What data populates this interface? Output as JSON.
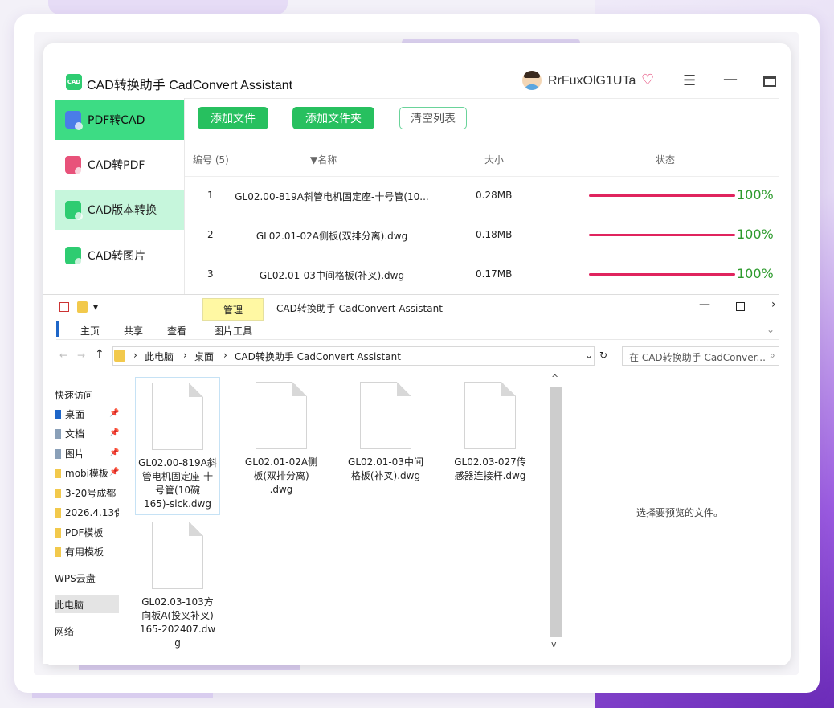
{
  "app": {
    "logo_text": "CAD",
    "title": "CAD转换助手 CadConvert Assistant",
    "username": "RrFuxOlG1UTa",
    "icons": {
      "vip": "diamond-icon",
      "menu": "hamburger-icon",
      "minimize": "minimize-icon",
      "maximize": "maximize-icon"
    },
    "nav": [
      {
        "label": "PDF转CAD",
        "icon_color": "#4a7de8",
        "state": "active"
      },
      {
        "label": "CAD转PDF",
        "icon_color": "#e8527a",
        "state": "normal"
      },
      {
        "label": "CAD版本转换",
        "icon_color": "#2ecc71",
        "state": "highlight"
      },
      {
        "label": "CAD转图片",
        "icon_color": "#2ecc71",
        "state": "normal"
      }
    ],
    "toolbar": {
      "add_file": "添加文件",
      "add_folder": "添加文件夹",
      "clear_list": "清空列表"
    },
    "table": {
      "headers": {
        "num": "编号 (5)",
        "name": "▼名称",
        "size": "大小",
        "status": "状态"
      },
      "rows": [
        {
          "num": "1",
          "name": "GL02.00-819A斜管电机固定座-十号管(10...",
          "size": "0.28MB",
          "progress": "100%"
        },
        {
          "num": "2",
          "name": "GL02.01-02A侧板(双排分离).dwg",
          "size": "0.18MB",
          "progress": "100%"
        },
        {
          "num": "3",
          "name": "GL02.01-03中间格板(补叉).dwg",
          "size": "0.17MB",
          "progress": "100%"
        }
      ]
    },
    "colors": {
      "accent_green": "#27c05f",
      "progress_bar": "#e0245e",
      "progress_text": "#2e9b2e"
    }
  },
  "explorer": {
    "quick_dropdown": "▾",
    "ribbon_context_tab": "管理",
    "window_title": "CAD转换助手 CadConvert Assistant",
    "window_controls": {
      "minimize": "—",
      "close": "›"
    },
    "ribbon_tabs": [
      "主页",
      "共享",
      "查看",
      "图片工具"
    ],
    "ribbon_expand": "⌄",
    "nav_arrows": {
      "back": "←",
      "forward": "→",
      "up": "↑"
    },
    "address": [
      "此电脑",
      "桌面",
      "CAD转换助手 CadConvert Assistant"
    ],
    "address_sep": "›",
    "address_dropdown": "⌄",
    "refresh": "↻",
    "search_placeholder": "在 CAD转换助手 CadConver...",
    "search_icon": "⌕",
    "tree": [
      {
        "label": "快速访问",
        "pinned": false,
        "icon_color": "#3b82f6"
      },
      {
        "label": "桌面",
        "pinned": true,
        "icon_color": "#1e66c8"
      },
      {
        "label": "文档",
        "pinned": true,
        "icon_color": "#8aa0b8"
      },
      {
        "label": "图片",
        "pinned": true,
        "icon_color": "#8aa0b8"
      },
      {
        "label": "mobi模板",
        "pinned": true,
        "icon_color": "#f2c94c"
      },
      {
        "label": "3-20号成都",
        "pinned": false,
        "icon_color": "#f2c94c"
      },
      {
        "label": "2026.4.13保",
        "pinned": false,
        "icon_color": "#f2c94c"
      },
      {
        "label": "PDF模板",
        "pinned": false,
        "icon_color": "#f2c94c"
      },
      {
        "label": "有用模板",
        "pinned": false,
        "icon_color": "#f2c94c"
      },
      {
        "label": "WPS云盘",
        "pinned": false,
        "icon_color": "#3b82f6"
      },
      {
        "label": "此电脑",
        "pinned": false,
        "icon_color": "#3b82f6"
      },
      {
        "label": "网络",
        "pinned": false,
        "icon_color": "#3b82f6"
      }
    ],
    "pin_glyph": "📌",
    "files": [
      {
        "lines": [
          "GL02.00-819A斜",
          "管电机固定座-十",
          "号管(10碗",
          "165)-sick.dwg"
        ]
      },
      {
        "lines": [
          "GL02.01-02A侧",
          "板(双排分离)",
          ".dwg"
        ]
      },
      {
        "lines": [
          "GL02.01-03中间",
          "格板(补叉).dwg"
        ]
      },
      {
        "lines": [
          "GL02.03-027传",
          "感器连接杆.dwg"
        ]
      },
      {
        "lines": [
          "GL02.03-103方",
          "向板A(投叉补叉)",
          "165-202407.dw",
          "g"
        ]
      }
    ],
    "scroll_glyphs": {
      "up": "^",
      "down": "v"
    },
    "preview_text": "选择要预览的文件。"
  }
}
